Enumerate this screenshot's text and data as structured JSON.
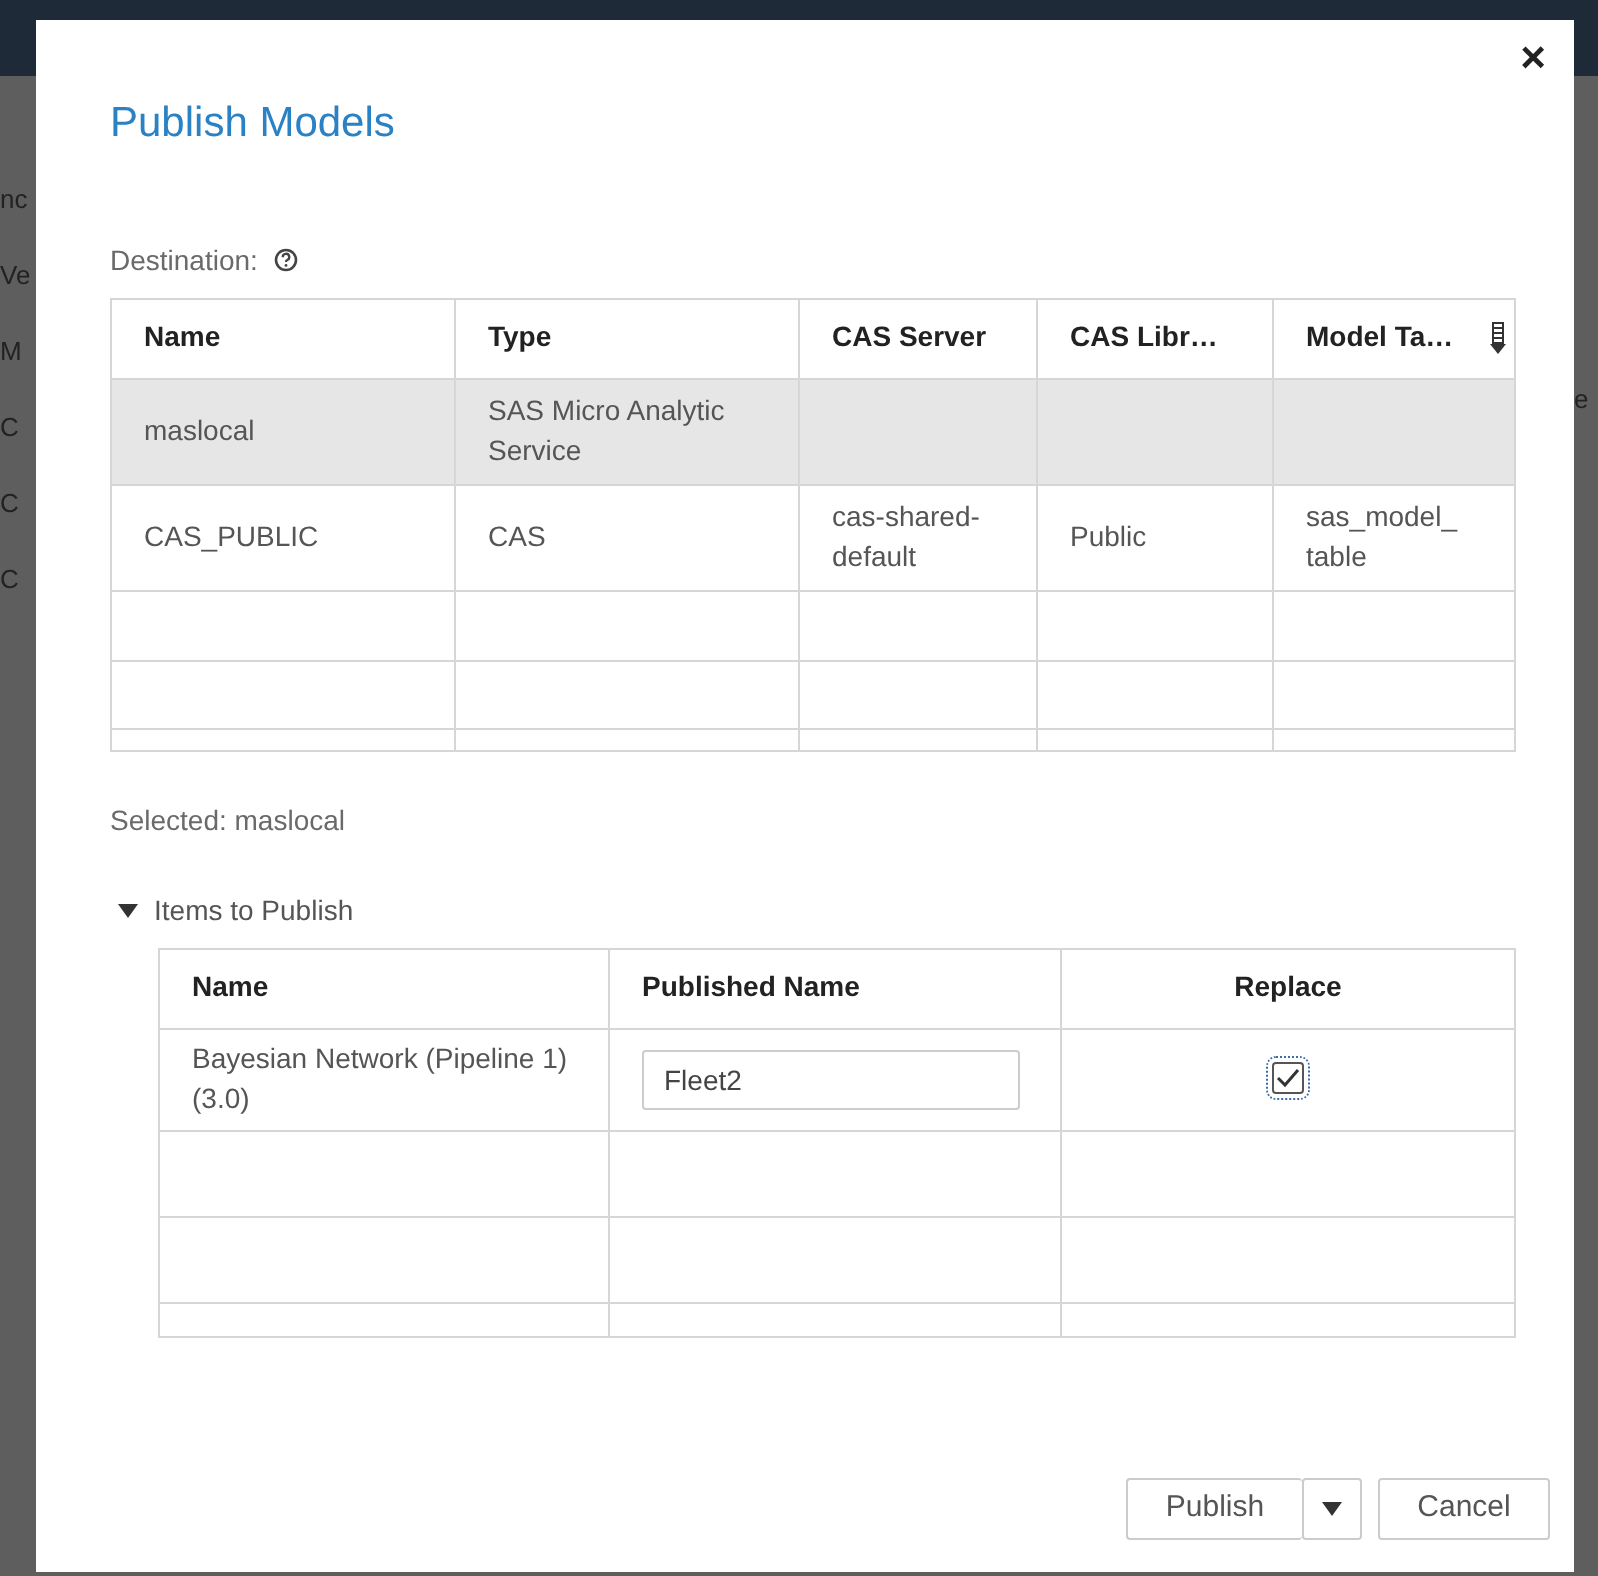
{
  "background": {
    "fragments_left": [
      "nc",
      "Ve",
      "M",
      "C",
      "C",
      "C"
    ],
    "fragments_right": [
      "e"
    ]
  },
  "dialog": {
    "title": "Publish Models",
    "close": "×",
    "destination": {
      "label": "Destination:",
      "columns": [
        "Name",
        "Type",
        "CAS Server",
        "CAS Libr…",
        "Model Ta…"
      ],
      "rows": [
        {
          "cells": [
            "maslocal",
            "SAS Micro Analytic Service",
            "",
            "",
            ""
          ],
          "selected": true
        },
        {
          "cells": [
            "CAS_PUBLIC",
            "CAS",
            "cas-shared-default",
            "Public",
            "sas_model_ table"
          ],
          "selected": false
        }
      ]
    },
    "selected_text": "Selected: maslocal",
    "items": {
      "label": "Items to Publish",
      "expanded": true,
      "columns": [
        "Name",
        "Published Name",
        "Replace"
      ],
      "rows": [
        {
          "name": "Bayesian Network (Pipeline 1) (3.0)",
          "published_name": "Fleet2",
          "replace": true
        }
      ]
    },
    "buttons": {
      "publish": "Publish",
      "cancel": "Cancel"
    }
  }
}
